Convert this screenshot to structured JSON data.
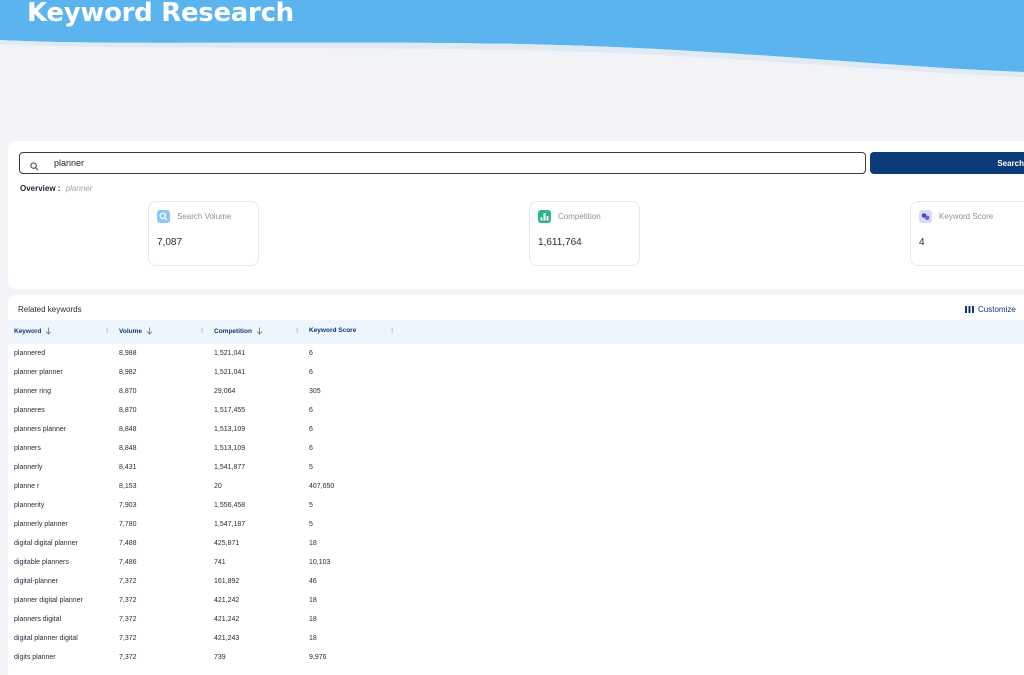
{
  "header": {
    "title": "Keyword Research",
    "banner_color": "#5cb4ef"
  },
  "search": {
    "value": "planner",
    "button_label": "Search",
    "icon": "search-icon"
  },
  "overview": {
    "label": "Overview :",
    "keyword": "planner"
  },
  "stats": [
    {
      "label": "Search Volume",
      "value": "7,087",
      "icon": "search-icon",
      "color": "#8cc7f5"
    },
    {
      "label": "Competition",
      "value": "1,611,764",
      "icon": "competition-bars-icon",
      "color": "#2fb586"
    },
    {
      "label": "Keyword Score",
      "value": "4",
      "icon": "link-icon",
      "color": "#4f46c8"
    }
  ],
  "related": {
    "title": "Related keywords",
    "customize_label": "Customize",
    "columns": [
      "Keyword",
      "Volume",
      "Competition",
      "Keyword Score"
    ],
    "rows": [
      [
        "plannered",
        "8,988",
        "1,521,041",
        "6"
      ],
      [
        "planner planner",
        "8,982",
        "1,521,041",
        "6"
      ],
      [
        "planner ring",
        "8,870",
        "29,064",
        "305"
      ],
      [
        "planneres",
        "8,870",
        "1,517,455",
        "6"
      ],
      [
        "planners planner",
        "8,848",
        "1,513,109",
        "6"
      ],
      [
        "planners",
        "8,848",
        "1,513,109",
        "6"
      ],
      [
        "plannerly",
        "8,431",
        "1,541,877",
        "5"
      ],
      [
        "planne r",
        "8,153",
        "20",
        "407,650"
      ],
      [
        "plannerity",
        "7,903",
        "1,556,458",
        "5"
      ],
      [
        "plannerly planner",
        "7,780",
        "1,547,187",
        "5"
      ],
      [
        "digital digital planner",
        "7,488",
        "425,871",
        "18"
      ],
      [
        "digitable planners",
        "7,486",
        "741",
        "10,103"
      ],
      [
        "digital-planner",
        "7,372",
        "161,892",
        "46"
      ],
      [
        "planner digital planner",
        "7,372",
        "421,242",
        "18"
      ],
      [
        "planners digital",
        "7,372",
        "421,242",
        "18"
      ],
      [
        "digital planner digital",
        "7,372",
        "421,243",
        "18"
      ],
      [
        "digits planner",
        "7,372",
        "739",
        "9,976"
      ]
    ]
  }
}
